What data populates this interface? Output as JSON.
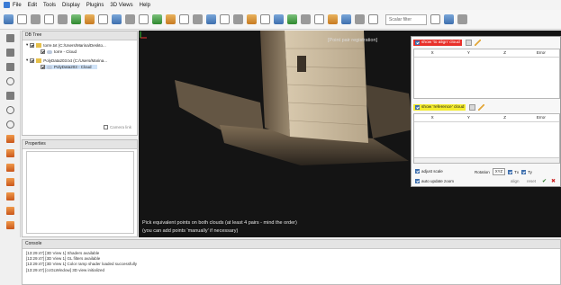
{
  "menubar": {
    "items": [
      "File",
      "Edit",
      "Tools",
      "Display",
      "Plugins",
      "3D Views",
      "Help"
    ]
  },
  "toolbar": {
    "filter_placeholder": "Scalar filter"
  },
  "db_tree": {
    "title": "DB Tree",
    "items": [
      {
        "label": "torre.txt (C:/Users/Marina/Deskto...",
        "level": 0
      },
      {
        "label": "torre - Cloud",
        "level": 1
      },
      {
        "label": "PolyData203.txt (C:/Users/Marina...",
        "level": 0
      },
      {
        "label": "PolyData203 - Cloud",
        "level": 1
      }
    ],
    "camera_link": "Camera link"
  },
  "properties": {
    "title": "Properties"
  },
  "view": {
    "title": "[Point pair registration]",
    "instructions": [
      "Pick equivalent points on both clouds (at least 4 pairs - mind the order)",
      "(you can add points 'manually' if necessary)"
    ]
  },
  "registration_panel": {
    "show_aligned": "show 'to align' cloud",
    "show_reference": "show 'reference' cloud",
    "columns": [
      "X",
      "Y",
      "Z",
      "Error"
    ],
    "adjust_scale": "adjust scale",
    "auto_update_zoom": "auto update zoom",
    "rotation_label": "Rotation",
    "rotation_value": "XYZ",
    "tx": "Tx",
    "ty": "Ty",
    "align_button": "align",
    "reset_button": "reset",
    "valid_icon": "check-icon",
    "cancel_icon": "close-icon"
  },
  "console": {
    "title": "Console",
    "lines": [
      "[13:29:47] [3D View 1] Shaders available",
      "[13:29:47] [3D View 1] GL filters available",
      "[13:29:47] [3D View 1] Color ramp shader loaded successfully",
      "[13:29:47] [ccGLWindow] 3D view initialized"
    ]
  },
  "colors": {
    "view_background": "#141414",
    "show_aligned_bg": "#e8302a",
    "show_reference_bg": "#f4ec2d",
    "stone": "#b8a68a"
  }
}
